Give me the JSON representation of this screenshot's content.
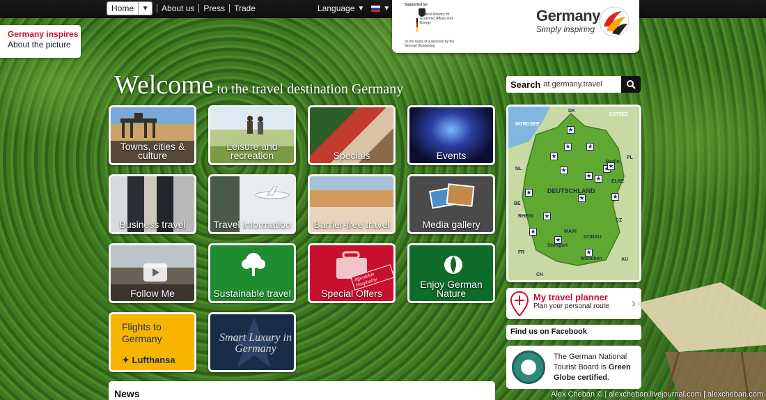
{
  "topbar": {
    "home_label": "Home",
    "links": [
      "About us",
      "Press",
      "Trade"
    ],
    "language_label": "Language"
  },
  "supporter": {
    "supported_by": "Supported by:",
    "ministry": "Federal Ministry for Economic Affairs and Energy",
    "decision": "on the basis of a decision by the German Bundestag",
    "brand_title": "Germany",
    "brand_sub": "Simply inspiring"
  },
  "inspires": {
    "title": "Germany inspires",
    "sub": "About the picture"
  },
  "welcome": {
    "big": "Welcome",
    "small": " to the travel destination Germany"
  },
  "tiles": [
    {
      "label": "Towns, cities & culture"
    },
    {
      "label": "Leisure and recreation"
    },
    {
      "label": "Specials"
    },
    {
      "label": "Events"
    },
    {
      "label": "Business travel"
    },
    {
      "label": "Travel information"
    },
    {
      "label": "Barrier-free travel"
    },
    {
      "label": "Media gallery"
    },
    {
      "label": "Follow Me"
    },
    {
      "label": "Sustainable travel"
    },
    {
      "label": "Special Offers"
    },
    {
      "label": "Enjoy German Nature"
    },
    {
      "label": "Flights to Germany",
      "sub": "Lufthansa"
    },
    {
      "label": "Smart Luxury in Germany"
    }
  ],
  "special_offers_tag": "Affordable Hospitality",
  "search": {
    "label": "Search",
    "sub": "at germany.travel"
  },
  "map": {
    "labels": [
      "DK",
      "OSTSEE",
      "NORDSEE",
      "NL",
      "PL",
      "DEUTSCHLAND",
      "ELBE",
      "RHEIN",
      "MAIN",
      "DONAU",
      "BE",
      "CZ",
      "FR",
      "AU",
      "CH",
      "Berlin",
      "München",
      "Stuttgart"
    ]
  },
  "planner": {
    "title": "My travel planner",
    "sub": "Plan your personal route"
  },
  "facebook": "Find us on Facebook",
  "globe": {
    "text_pre": "The German National Tourist Board is ",
    "text_bold": "Green Globe certified",
    "text_post": "."
  },
  "news": "News",
  "credit": "Alex Cheban © | alexcheban.livejournal.com | alexcheban.com"
}
